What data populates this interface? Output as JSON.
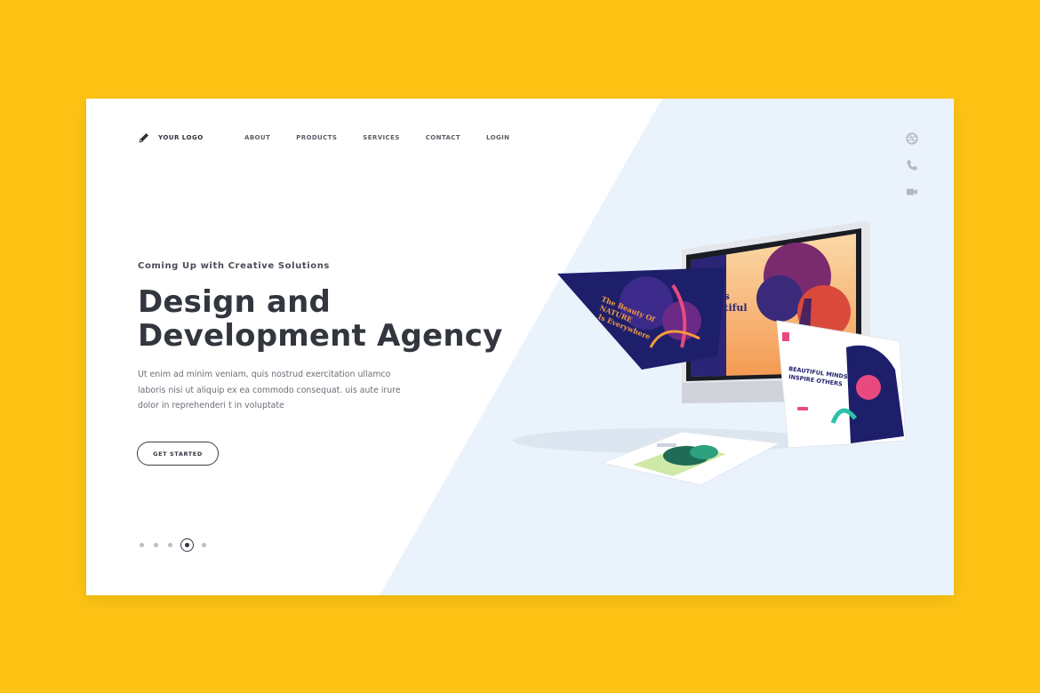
{
  "logo": {
    "text": "YOUR LOGO",
    "icon": "pencil-icon"
  },
  "nav": {
    "items": [
      {
        "label": "ABOUT"
      },
      {
        "label": "PRODUCTS"
      },
      {
        "label": "SERVICES"
      },
      {
        "label": "CONTACT"
      },
      {
        "label": "LOGIN"
      }
    ]
  },
  "side_icons": [
    "dribbble-icon",
    "phone-icon",
    "video-camera-icon"
  ],
  "hero": {
    "eyebrow": "Coming Up with Creative Solutions",
    "headline_line1": "Design and",
    "headline_line2": "Development Agency",
    "body_line1": "Ut enim ad minim veniam, quis nostrud exercitation ullamco",
    "body_line2": "laboris nisi ut aliquip ex ea commodo consequat. uis aute irure",
    "body_line3": "dolor in reprehenderi t in voluptate",
    "cta_label": "GET STARTED"
  },
  "slider": {
    "total": 5,
    "active": 4
  },
  "mockups": {
    "monitor_title_line1": "Life is",
    "monitor_title_line2": "Beautiful",
    "left_screen_line1": "The Beauty Of",
    "left_screen_line2": "NATURE",
    "left_screen_line3": "Is Everywhere",
    "right_screen_line1": "BEAUTIFUL MINDS",
    "right_screen_line2": "INSPIRE OTHERS"
  },
  "colors": {
    "background": "#FDC314",
    "card": "#FFFFFF",
    "panel": "#EAF3FC",
    "text_dark": "#33363F",
    "mock_navy": "#1E1F6B",
    "mock_orange": "#F59A3E",
    "mock_pink": "#E84A7F"
  }
}
